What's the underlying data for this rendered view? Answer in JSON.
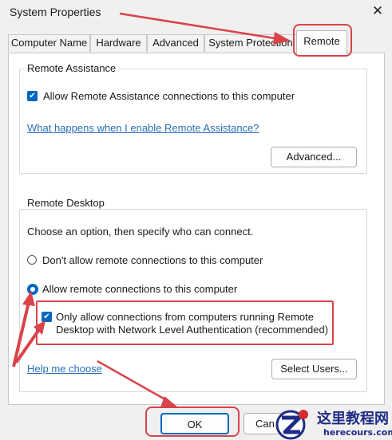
{
  "window": {
    "title": "System Properties",
    "close_symbol": "✕"
  },
  "tabs": [
    {
      "label": "Computer Name"
    },
    {
      "label": "Hardware"
    },
    {
      "label": "Advanced"
    },
    {
      "label": "System Protection"
    },
    {
      "label": "Remote",
      "active": true
    }
  ],
  "remote_assistance": {
    "legend": "Remote Assistance",
    "allow_checkbox_label": "Allow Remote Assistance connections to this computer",
    "allow_checked": true,
    "help_link": "What happens when I enable Remote Assistance?",
    "advanced_button": "Advanced..."
  },
  "remote_desktop": {
    "legend": "Remote Desktop",
    "instruction": "Choose an option, then specify who can connect.",
    "option_dont_allow": "Don't allow remote connections to this computer",
    "option_allow": "Allow remote connections to this computer",
    "selected_option": "allow",
    "nla_label_line1": "Only allow connections from computers running Remote",
    "nla_label_line2": "Desktop with Network Level Authentication (recommended)",
    "nla_checked": true,
    "help_link": "Help me choose",
    "select_users_button": "Select Users..."
  },
  "footer": {
    "ok_button": "OK",
    "cancel_button_visible_text": "Can"
  },
  "annotation_color": "#d9434a",
  "accent_color": "#0067c0",
  "watermark": {
    "line1": "这里教程网",
    "line2": "herecours.com"
  }
}
